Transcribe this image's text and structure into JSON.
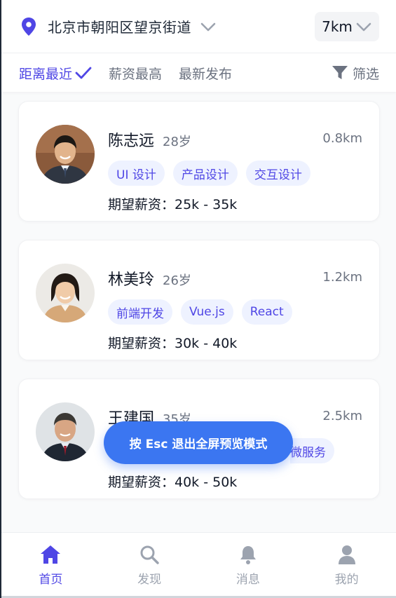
{
  "header": {
    "location": "北京市朝阳区望京街道",
    "distance": "7km"
  },
  "tabs": [
    {
      "label": "距离最近",
      "active": true
    },
    {
      "label": "薪资最高",
      "active": false
    },
    {
      "label": "最新发布",
      "active": false
    }
  ],
  "filter_label": "筛选",
  "candidates": [
    {
      "name": "陈志远",
      "age": "28岁",
      "distance": "0.8km",
      "tags": [
        "UI 设计",
        "产品设计",
        "交互设计"
      ],
      "salary": "期望薪资：25k - 35k"
    },
    {
      "name": "林美玲",
      "age": "26岁",
      "distance": "1.2km",
      "tags": [
        "前端开发",
        "Vue.js",
        "React"
      ],
      "salary": "期望薪资：30k - 40k"
    },
    {
      "name": "王建国",
      "age": "35岁",
      "distance": "2.5km",
      "tags": [
        "微服务"
      ],
      "salary": "期望薪资：40k - 50k"
    }
  ],
  "toast": "按 Esc 退出全屏预览模式",
  "nav": [
    {
      "label": "首页",
      "icon": "home-icon",
      "active": true
    },
    {
      "label": "发现",
      "icon": "search-icon",
      "active": false
    },
    {
      "label": "消息",
      "icon": "bell-icon",
      "active": false
    },
    {
      "label": "我的",
      "icon": "user-icon",
      "active": false
    }
  ],
  "colors": {
    "accent": "#4f46e5",
    "toast": "#3b76f1",
    "tag_bg": "#eef2ff"
  }
}
